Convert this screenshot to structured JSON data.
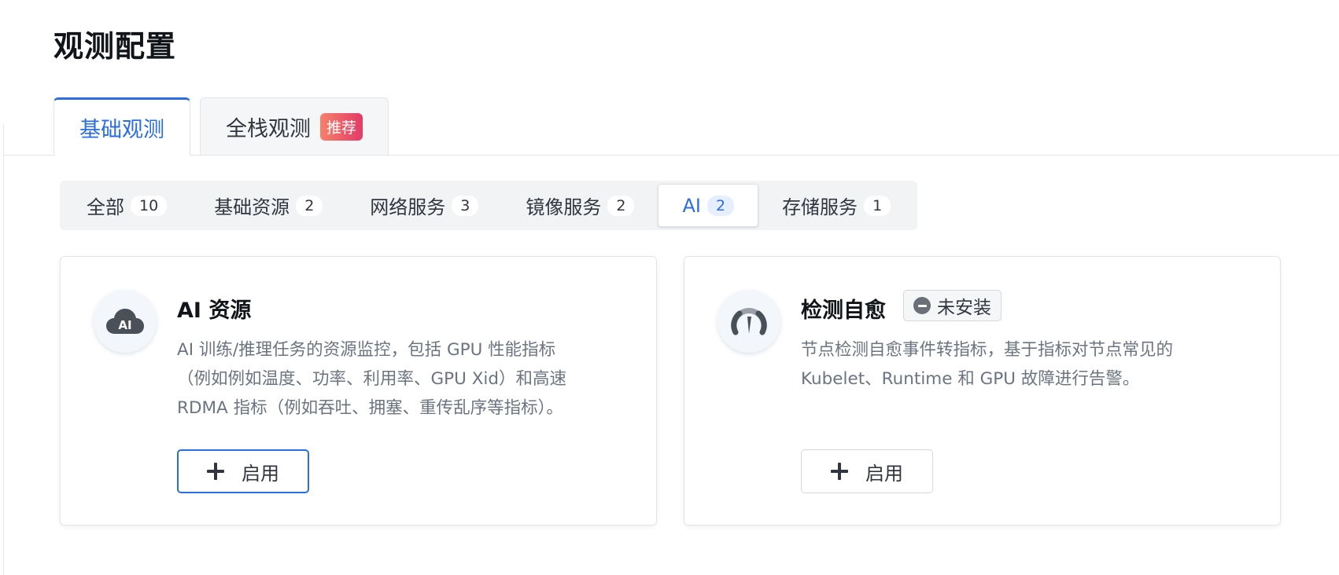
{
  "page": {
    "title": "观测配置"
  },
  "main_tabs": [
    {
      "label": "基础观测",
      "active": true
    },
    {
      "label": "全栈观测",
      "badge": "推荐",
      "active": false
    }
  ],
  "filters": [
    {
      "label": "全部",
      "count": "10"
    },
    {
      "label": "基础资源",
      "count": "2"
    },
    {
      "label": "网络服务",
      "count": "3"
    },
    {
      "label": "镜像服务",
      "count": "2"
    },
    {
      "label": "AI",
      "count": "2",
      "active": true
    },
    {
      "label": "存储服务",
      "count": "1"
    }
  ],
  "cards": [
    {
      "title": "AI 资源",
      "icon": "ai-cloud-icon",
      "icon_text": "AI",
      "desc_lines": [
        "AI 训练/推理任务的资源监控，包括 GPU 性能指标",
        "（例如例如温度、功率、利用率、GPU Xid）和高速",
        "RDMA 指标（例如吞吐、拥塞、重传乱序等指标）。"
      ],
      "button_label": "启用"
    },
    {
      "title": "检测自愈",
      "icon": "gauge-icon",
      "status": "未安装",
      "desc_lines": [
        "节点检测自愈事件转指标，基于指标对节点常见的",
        "Kubelet、Runtime 和 GPU 故障进行告警。"
      ],
      "button_label": "启用"
    }
  ],
  "colors": {
    "accent": "#2a6ee6",
    "badge_from": "#f7816a",
    "badge_to": "#e43a68"
  }
}
